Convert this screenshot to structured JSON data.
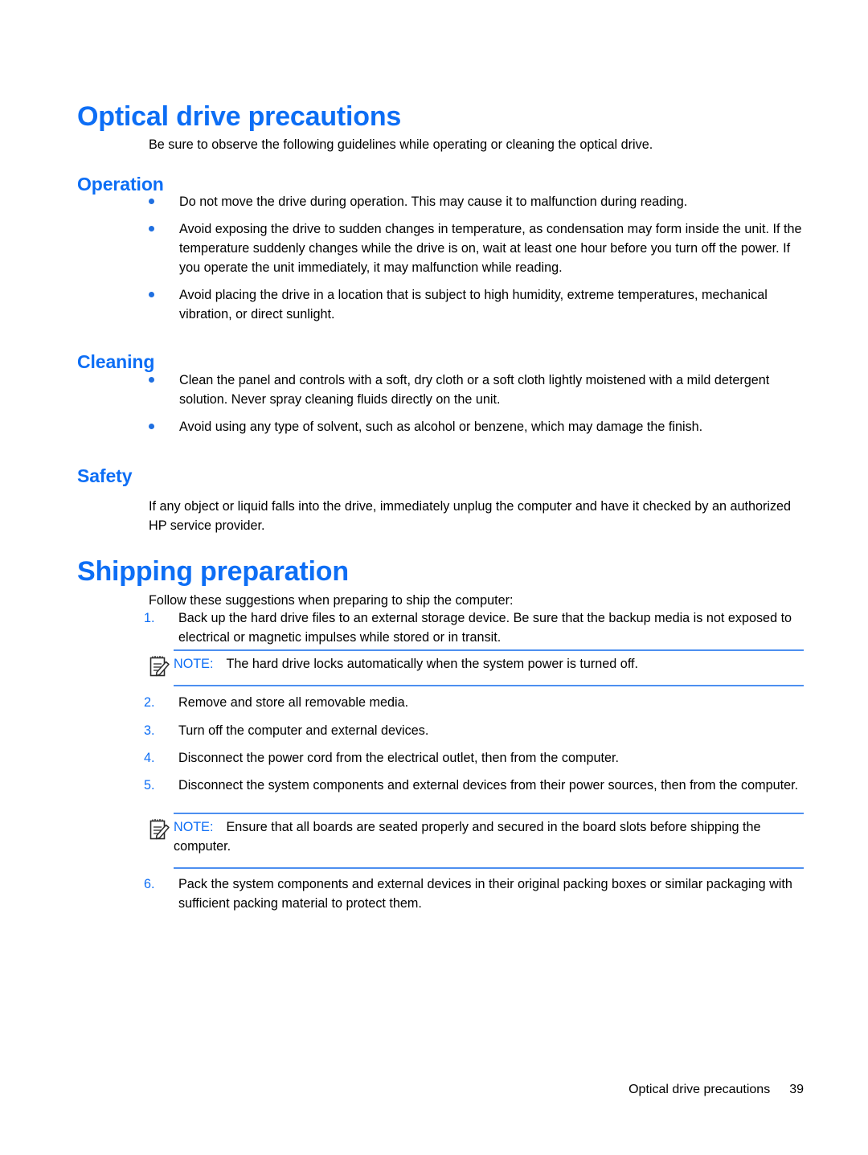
{
  "document": {
    "title": "Optical drive precautions"
  },
  "sections": {
    "optical": {
      "heading": "Optical drive precautions",
      "intro": "Be sure to observe the following guidelines while operating or cleaning the optical drive.",
      "operation": {
        "heading": "Operation",
        "bullets": [
          "Do not move the drive during operation. This may cause it to malfunction during reading.",
          "Avoid exposing the drive to sudden changes in temperature, as condensation may form inside the unit. If the temperature suddenly changes while the drive is on, wait at least one hour before you turn off the power. If you operate the unit immediately, it may malfunction while reading.",
          "Avoid placing the drive in a location that is subject to high humidity, extreme temperatures, mechanical vibration, or direct sunlight."
        ]
      },
      "cleaning": {
        "heading": "Cleaning",
        "bullets": [
          "Clean the panel and controls with a soft, dry cloth or a soft cloth lightly moistened with a mild detergent solution. Never spray cleaning fluids directly on the unit.",
          "Avoid using any type of solvent, such as alcohol or benzene, which may damage the finish."
        ]
      },
      "safety": {
        "heading": "Safety",
        "paragraph": "If any object or liquid falls into the drive, immediately unplug the computer and have it checked by an authorized HP service provider."
      }
    },
    "shipping": {
      "heading": "Shipping preparation",
      "intro": "Follow these suggestions when preparing to ship the computer:",
      "steps": [
        {
          "marker": "1.",
          "text": "Back up the hard drive files to an external storage device. Be sure that the backup media is not exposed to electrical or magnetic impulses while stored or in transit."
        },
        {
          "marker": "2.",
          "text": "Remove and store all removable media."
        },
        {
          "marker": "3.",
          "text": "Turn off the computer and external devices."
        },
        {
          "marker": "4.",
          "text": "Disconnect the power cord from the electrical outlet, then from the computer."
        },
        {
          "marker": "5.",
          "text": "Disconnect the system components and external devices from their power sources, then from the computer."
        },
        {
          "marker": "6.",
          "text": "Pack the system components and external devices in their original packing boxes or similar packaging with sufficient packing material to protect them."
        }
      ],
      "note_1": {
        "label": "NOTE:",
        "text": "The hard drive locks automatically when the system power is turned off."
      },
      "note_2": {
        "label": "NOTE:",
        "text": "Ensure that all boards are seated properly and secured in the board slots before shipping the computer."
      }
    }
  },
  "footer": {
    "running_title": "Optical drive precautions",
    "page_number": "39"
  },
  "colors": {
    "heading_blue": "#0d6ef5",
    "rule_blue": "#4d8ff0",
    "bullet_blue": "#1f6fe0",
    "text_black": "#000000"
  }
}
